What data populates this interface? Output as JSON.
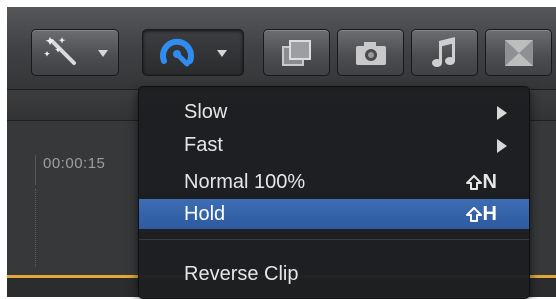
{
  "toolbar": {
    "buttons": [
      {
        "name": "effects-wand",
        "icon": "magic-wand-icon"
      },
      {
        "name": "retime",
        "icon": "retime-speedometer-icon",
        "accent": "#2f8df0"
      },
      {
        "name": "video-effects",
        "icon": "overlapping-frames-icon"
      },
      {
        "name": "photos",
        "icon": "camera-icon"
      },
      {
        "name": "music",
        "icon": "music-note-icon"
      },
      {
        "name": "transitions",
        "icon": "transition-x-icon"
      }
    ]
  },
  "timeline": {
    "timecode": "00:00:15",
    "accent": "#e0a83a"
  },
  "retime_menu": {
    "items": [
      {
        "label": "Slow",
        "shortcut": "",
        "submenu": true,
        "highlighted": false
      },
      {
        "label": "Fast",
        "shortcut": "",
        "submenu": true,
        "highlighted": false
      },
      {
        "label": "Normal 100%",
        "shortcut": "N",
        "shortcut_modifier": "shift-icon",
        "submenu": false,
        "highlighted": false
      },
      {
        "label": "Hold",
        "shortcut": "H",
        "shortcut_modifier": "shift-icon",
        "submenu": false,
        "highlighted": true
      },
      {
        "label": "Reverse Clip",
        "shortcut": "",
        "submenu": false,
        "highlighted": false
      }
    ],
    "highlight_color": "#3563a8"
  }
}
